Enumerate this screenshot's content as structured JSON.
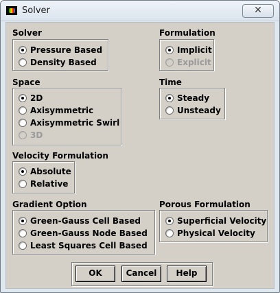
{
  "window": {
    "title": "Solver",
    "icon": "fluent-app-icon",
    "close_label": "✕"
  },
  "solver": {
    "title": "Solver",
    "options": [
      {
        "label": "Pressure Based",
        "checked": true,
        "enabled": true
      },
      {
        "label": "Density Based",
        "checked": false,
        "enabled": true
      }
    ]
  },
  "formulation": {
    "title": "Formulation",
    "options": [
      {
        "label": "Implicit",
        "checked": true,
        "enabled": true
      },
      {
        "label": "Explicit",
        "checked": false,
        "enabled": false
      }
    ]
  },
  "space": {
    "title": "Space",
    "options": [
      {
        "label": "2D",
        "checked": true,
        "enabled": true
      },
      {
        "label": "Axisymmetric",
        "checked": false,
        "enabled": true
      },
      {
        "label": "Axisymmetric Swirl",
        "checked": false,
        "enabled": true
      },
      {
        "label": "3D",
        "checked": false,
        "enabled": false
      }
    ]
  },
  "time": {
    "title": "Time",
    "options": [
      {
        "label": "Steady",
        "checked": true,
        "enabled": true
      },
      {
        "label": "Unsteady",
        "checked": false,
        "enabled": true
      }
    ]
  },
  "velocity_formulation": {
    "title": "Velocity Formulation",
    "options": [
      {
        "label": "Absolute",
        "checked": true,
        "enabled": true
      },
      {
        "label": "Relative",
        "checked": false,
        "enabled": true
      }
    ]
  },
  "gradient_option": {
    "title": "Gradient Option",
    "options": [
      {
        "label": "Green-Gauss Cell Based",
        "checked": true,
        "enabled": true
      },
      {
        "label": "Green-Gauss Node Based",
        "checked": false,
        "enabled": true
      },
      {
        "label": "Least Squares Cell Based",
        "checked": false,
        "enabled": true
      }
    ]
  },
  "porous_formulation": {
    "title": "Porous Formulation",
    "options": [
      {
        "label": "Superficial Velocity",
        "checked": true,
        "enabled": true
      },
      {
        "label": "Physical Velocity",
        "checked": false,
        "enabled": true
      }
    ]
  },
  "buttons": {
    "ok": "OK",
    "cancel": "Cancel",
    "help": "Help"
  }
}
